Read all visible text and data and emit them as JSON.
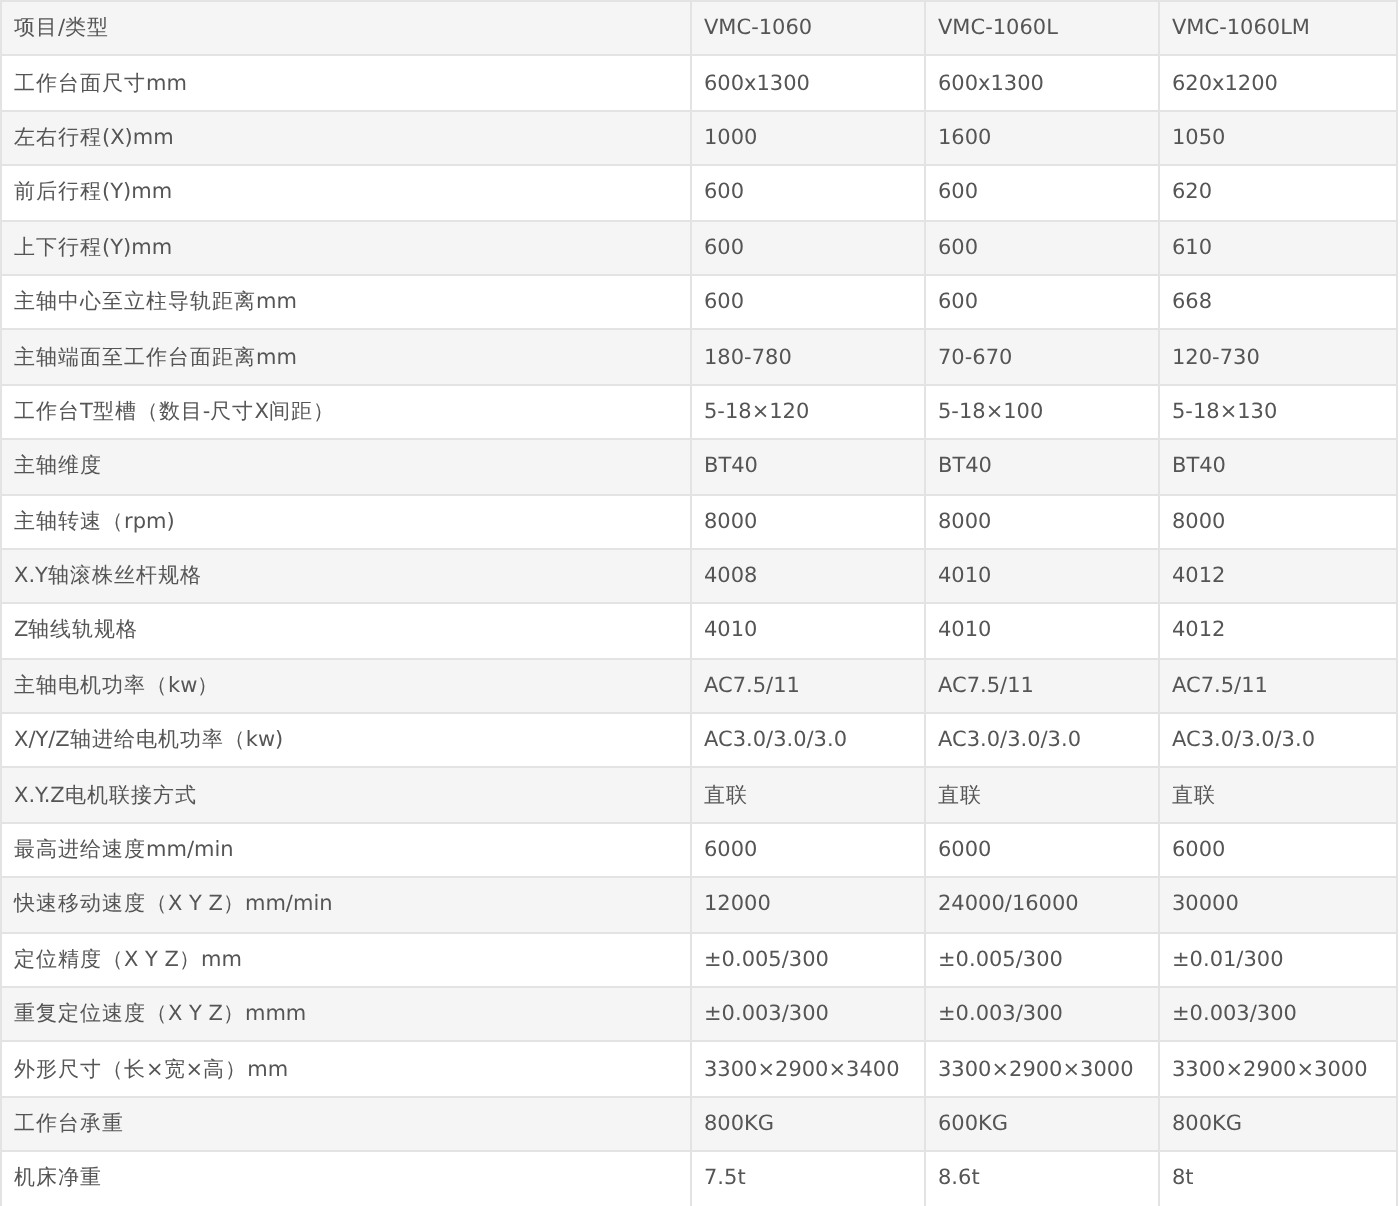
{
  "table": {
    "columns": [
      "项目/类型",
      "VMC-1060",
      "VMC-1060L",
      "VMC-1060LM"
    ],
    "rows": [
      [
        "工作台面尺寸mm",
        "600x1300",
        "600x1300",
        "620x1200"
      ],
      [
        "左右行程(X)mm",
        "1000",
        "1600",
        "1050"
      ],
      [
        "前后行程(Y)mm",
        "600",
        "600",
        "620"
      ],
      [
        "上下行程(Y)mm",
        "600",
        "600",
        "610"
      ],
      [
        "主轴中心至立柱导轨距离mm",
        "600",
        "600",
        "668"
      ],
      [
        "主轴端面至工作台面距离mm",
        "180-780",
        "70-670",
        "120-730"
      ],
      [
        "工作台T型槽（数目-尺寸X间距）",
        "5-18×120",
        "5-18×100",
        "5-18×130"
      ],
      [
        "主轴维度",
        "BT40",
        "BT40",
        "BT40"
      ],
      [
        "主轴转速（rpm)",
        "8000",
        "8000",
        "8000"
      ],
      [
        "X.Y轴滚株丝杆规格",
        "4008",
        "4010",
        "4012"
      ],
      [
        "Z轴线轨规格",
        "4010",
        "4010",
        "4012"
      ],
      [
        "主轴电机功率（kw）",
        "AC7.5/11",
        "AC7.5/11",
        "AC7.5/11"
      ],
      [
        "X/Y/Z轴进给电机功率（kw)",
        "AC3.0/3.0/3.0",
        "AC3.0/3.0/3.0",
        "AC3.0/3.0/3.0"
      ],
      [
        "X.Y.Z电机联接方式",
        "直联",
        "直联",
        "直联"
      ],
      [
        "最高进给速度mm/min",
        "6000",
        "6000",
        "6000"
      ],
      [
        "快速移动速度（X Y Z）mm/min",
        "12000",
        "24000/16000",
        "30000"
      ],
      [
        "定位精度（X Y Z）mm",
        "±0.005/300",
        "±0.005/300",
        "±0.01/300"
      ],
      [
        "重复定位速度（X Y Z）mmm",
        "±0.003/300",
        "±0.003/300",
        "±0.003/300"
      ],
      [
        "外形尺寸（长×宽×高）mm",
        "3300×2900×3400",
        "3300×2900×3000",
        "3300×2900×3000"
      ],
      [
        "工作台承重",
        "800KG",
        "600KG",
        "800KG"
      ],
      [
        "机床净重",
        "7.5t",
        "8.6t",
        "8t"
      ]
    ]
  }
}
